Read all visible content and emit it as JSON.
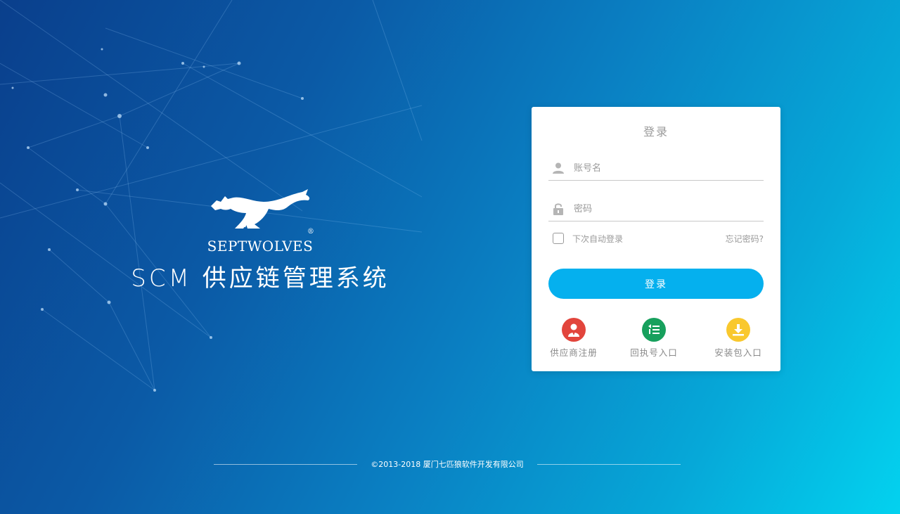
{
  "brand": {
    "name": "SEPTWOLVES",
    "registered_mark": "®",
    "system_title": "SCM 供应链管理系统"
  },
  "login": {
    "title": "登录",
    "username_placeholder": "账号名",
    "password_placeholder": "密码",
    "remember_label": "下次自动登录",
    "forgot_label": "忘记密码?",
    "submit_label": "登录"
  },
  "entries": [
    {
      "label": "供应商注册",
      "icon": "supplier-user-icon",
      "color": "#e2453c"
    },
    {
      "label": "回执号入口",
      "icon": "receipt-list-icon",
      "color": "#17a05d"
    },
    {
      "label": "安装包入口",
      "icon": "download-icon",
      "color": "#f9c82e"
    }
  ],
  "footer": {
    "copyright": "©2013-2018  厦门七匹狼软件开发有限公司"
  },
  "colors": {
    "accent": "#05b0ee",
    "bg_start": "#0a3f8c",
    "bg_end": "#03d2ef"
  }
}
